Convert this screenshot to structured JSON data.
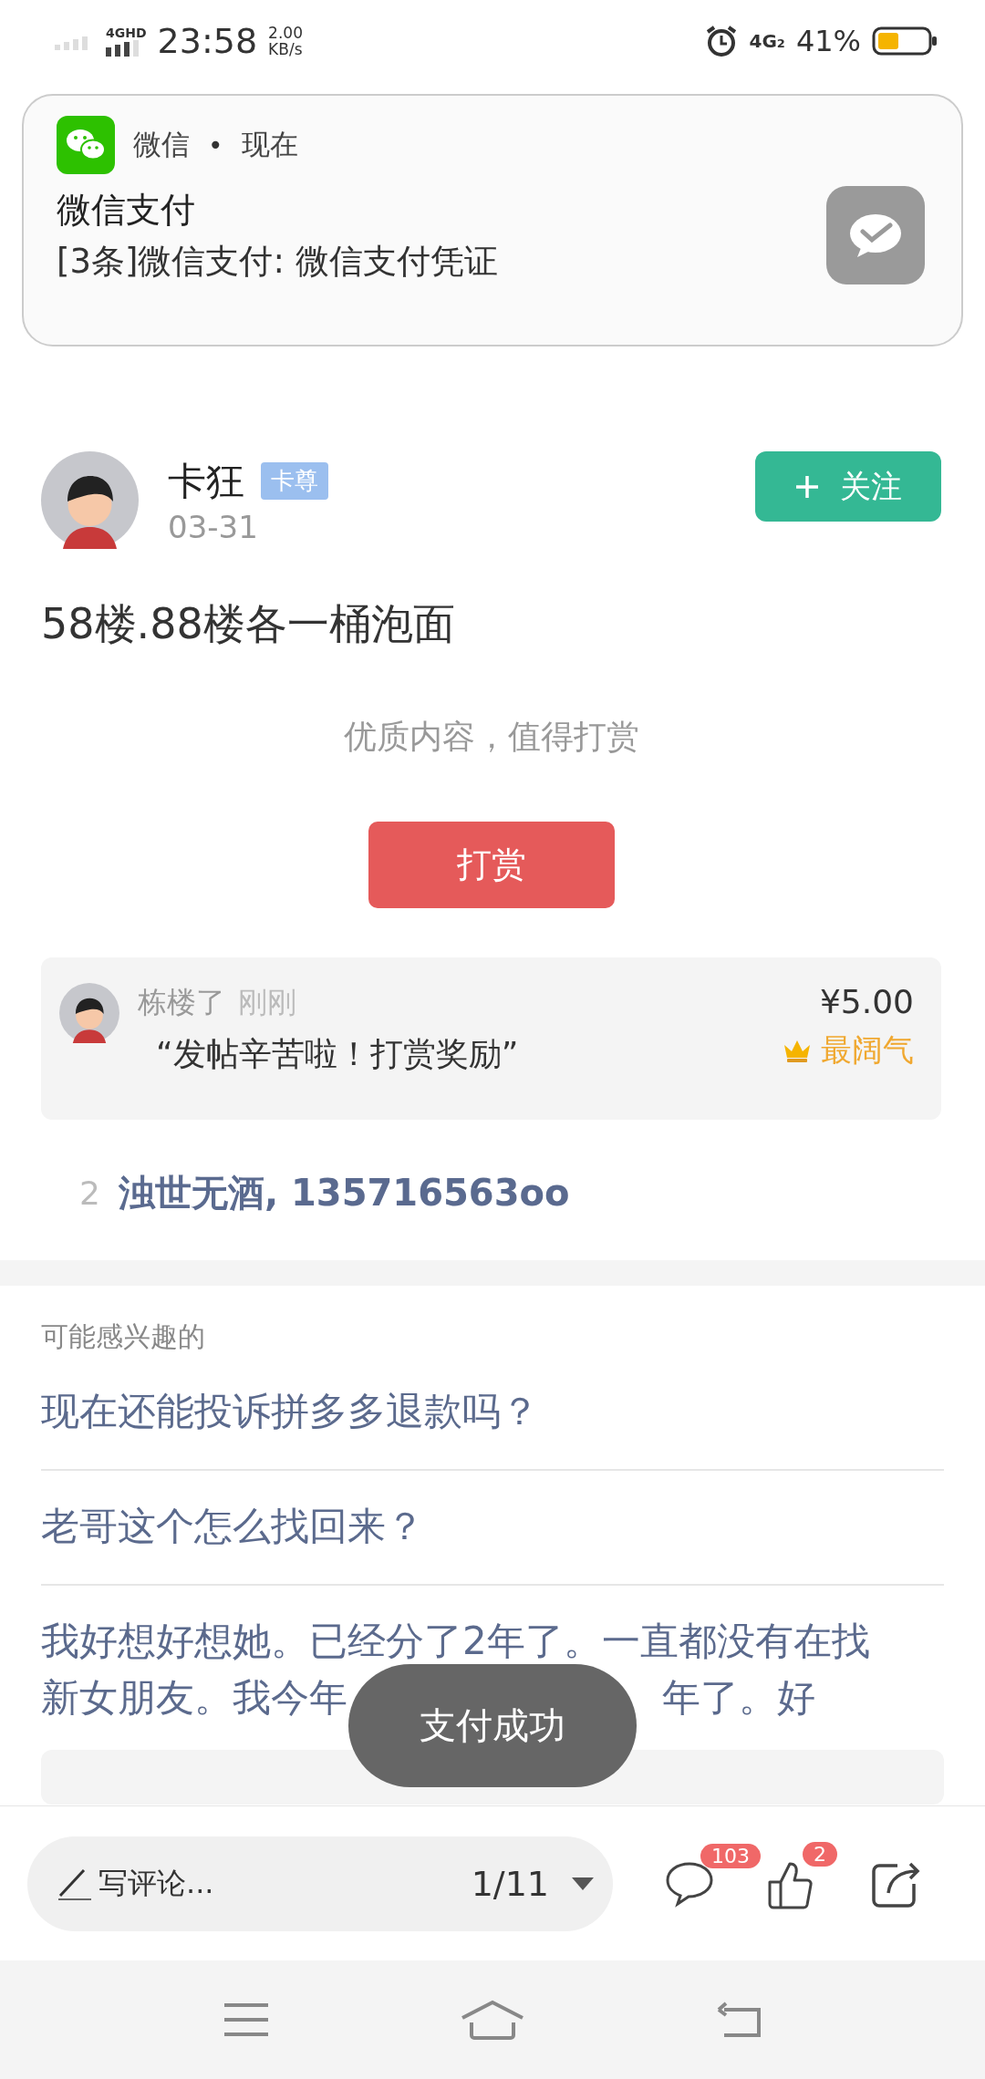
{
  "status_bar": {
    "network": "4GHD",
    "time": "23:58",
    "speed": "2.00",
    "speed_unit": "KB/s",
    "network2": "4G",
    "sim": "2",
    "battery": "41%"
  },
  "notification": {
    "app": "微信",
    "separator": "•",
    "time": "现在",
    "title": "微信支付",
    "body": "[3条]微信支付: 微信支付凭证"
  },
  "post": {
    "author": "卡狂",
    "badge": "卡尊",
    "date": "03-31",
    "follow": "关注",
    "content": "58楼.88楼各一桶泡面",
    "reward_prompt": "优质内容，值得打赏",
    "reward_button": "打赏"
  },
  "reward": {
    "name": "栋楼了",
    "time": "刚刚",
    "quote": "“发帖辛苦啦！打赏奖励”",
    "amount": "¥5.00",
    "tag": "最阔气"
  },
  "rewarders": {
    "count": "2",
    "names": "浊世无酒, 135716563oo"
  },
  "related": {
    "heading": "可能感兴趣的",
    "items": [
      {
        "lines": [
          [
            "现在还能投诉拼多多退款吗？"
          ]
        ]
      },
      {
        "lines": [
          [
            "老哥这个怎么找回来？"
          ]
        ]
      },
      {
        "lines": [
          [
            "我好想好想她。已经分了2年了。一直都没有在找"
          ],
          [
            "新女朋友。我今年",
            "年了。好"
          ]
        ]
      }
    ]
  },
  "toast": "支付成功",
  "bottom_bar": {
    "placeholder": "写评论...",
    "page": "1/11",
    "comment_count": "103",
    "like_count": "2"
  }
}
